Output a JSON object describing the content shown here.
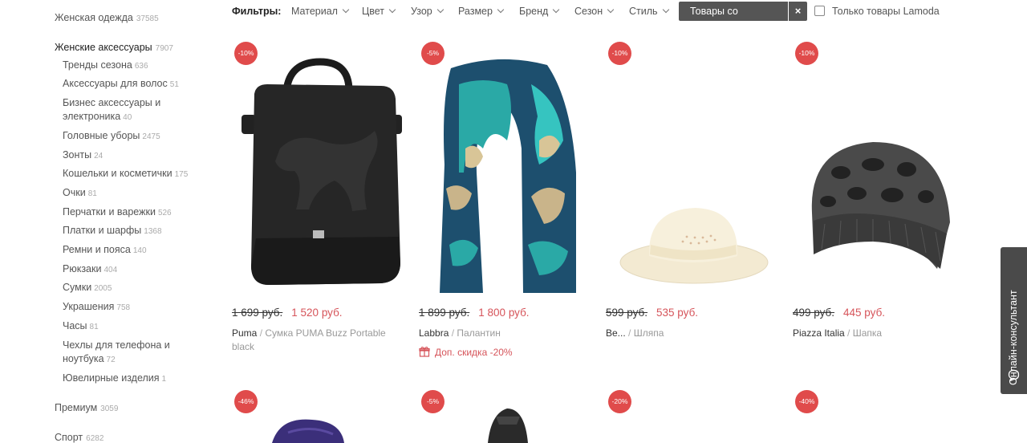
{
  "sidebar": {
    "top_before": [
      {
        "label": "Женская одежда",
        "count": "37585"
      }
    ],
    "active": {
      "label": "Женские аксессуары",
      "count": "7907"
    },
    "subcategories": [
      {
        "label": "Тренды сезона",
        "count": "636"
      },
      {
        "label": "Аксессуары для волос",
        "count": "51"
      },
      {
        "label": "Бизнес аксессуары и электроника",
        "count": "40"
      },
      {
        "label": "Головные уборы",
        "count": "2475"
      },
      {
        "label": "Зонты",
        "count": "24"
      },
      {
        "label": "Кошельки и косметички",
        "count": "175"
      },
      {
        "label": "Очки",
        "count": "81"
      },
      {
        "label": "Перчатки и варежки",
        "count": "526"
      },
      {
        "label": "Платки и шарфы",
        "count": "1368"
      },
      {
        "label": "Ремни и пояса",
        "count": "140"
      },
      {
        "label": "Рюкзаки",
        "count": "404"
      },
      {
        "label": "Сумки",
        "count": "2005"
      },
      {
        "label": "Украшения",
        "count": "758"
      },
      {
        "label": "Часы",
        "count": "81"
      },
      {
        "label": "Чехлы для телефона и ноутбука",
        "count": "72"
      },
      {
        "label": "Ювелирные изделия",
        "count": "1"
      }
    ],
    "top_after": [
      {
        "label": "Премиум",
        "count": "3059"
      },
      {
        "label": "Спорт",
        "count": "6282"
      }
    ]
  },
  "filters": {
    "title": "Фильтры:",
    "items": [
      "Материал",
      "Цвет",
      "Узор",
      "Размер",
      "Бренд",
      "Сезон",
      "Стиль"
    ],
    "active_chip": "Товары со скидкой",
    "chip_close": "×",
    "lamoda_only": "Только товары Lamoda"
  },
  "products": [
    {
      "discount": "-10%",
      "old_price": "1 699 руб.",
      "price": "1 520 руб.",
      "brand": "Puma",
      "type": "Сумка PUMA Buzz Portable black",
      "image": "bag-image"
    },
    {
      "discount": "-5%",
      "old_price": "1 899 руб.",
      "price": "1 800 руб.",
      "brand": "Labbra",
      "type": "Палантин",
      "extra": "Доп. скидка -20%",
      "image": "scarf-image"
    },
    {
      "discount": "-10%",
      "old_price": "599 руб.",
      "price": "535 руб.",
      "brand": "Be...",
      "type": "Шляпа",
      "image": "hat-image"
    },
    {
      "discount": "-10%",
      "old_price": "499 руб.",
      "price": "445 руб.",
      "brand": "Piazza Italia",
      "type": "Шапка",
      "image": "beanie-image"
    }
  ],
  "products_row2": [
    {
      "discount": "-46%"
    },
    {
      "discount": "-5%"
    },
    {
      "discount": "-20%"
    },
    {
      "discount": "-40%"
    }
  ],
  "consultant": {
    "label": "Онлайн-консультант",
    "icon": "chat-bubble-icon"
  },
  "colors": {
    "accent": "#d6545a",
    "badge": "#e04b4b",
    "chip": "#555555",
    "tab": "#4a4a4a"
  }
}
